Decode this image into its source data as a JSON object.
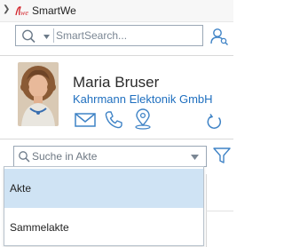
{
  "app": {
    "title": "SmartWe",
    "logo_text": "We"
  },
  "search": {
    "placeholder": "SmartSearch..."
  },
  "contact": {
    "name": "Maria Bruser",
    "company": "Kahrmann Elektonik GmbH"
  },
  "akte_search": {
    "placeholder": "Suche in Akte"
  },
  "dropdown": {
    "items": [
      {
        "label": "Akte",
        "selected": true
      },
      {
        "label": "Sammelakte",
        "selected": false
      }
    ]
  },
  "colors": {
    "accent": "#1f6fbf",
    "icon_blue": "#3f83c6",
    "selection": "#cfe3f4",
    "logo_red": "#d2232a"
  },
  "icons": {
    "expand": "chevron-right-icon",
    "search": "search-icon",
    "person_search": "person-search-icon",
    "mail": "mail-icon",
    "phone": "phone-icon",
    "location": "location-icon",
    "refresh": "refresh-icon",
    "filter": "filter-icon"
  }
}
